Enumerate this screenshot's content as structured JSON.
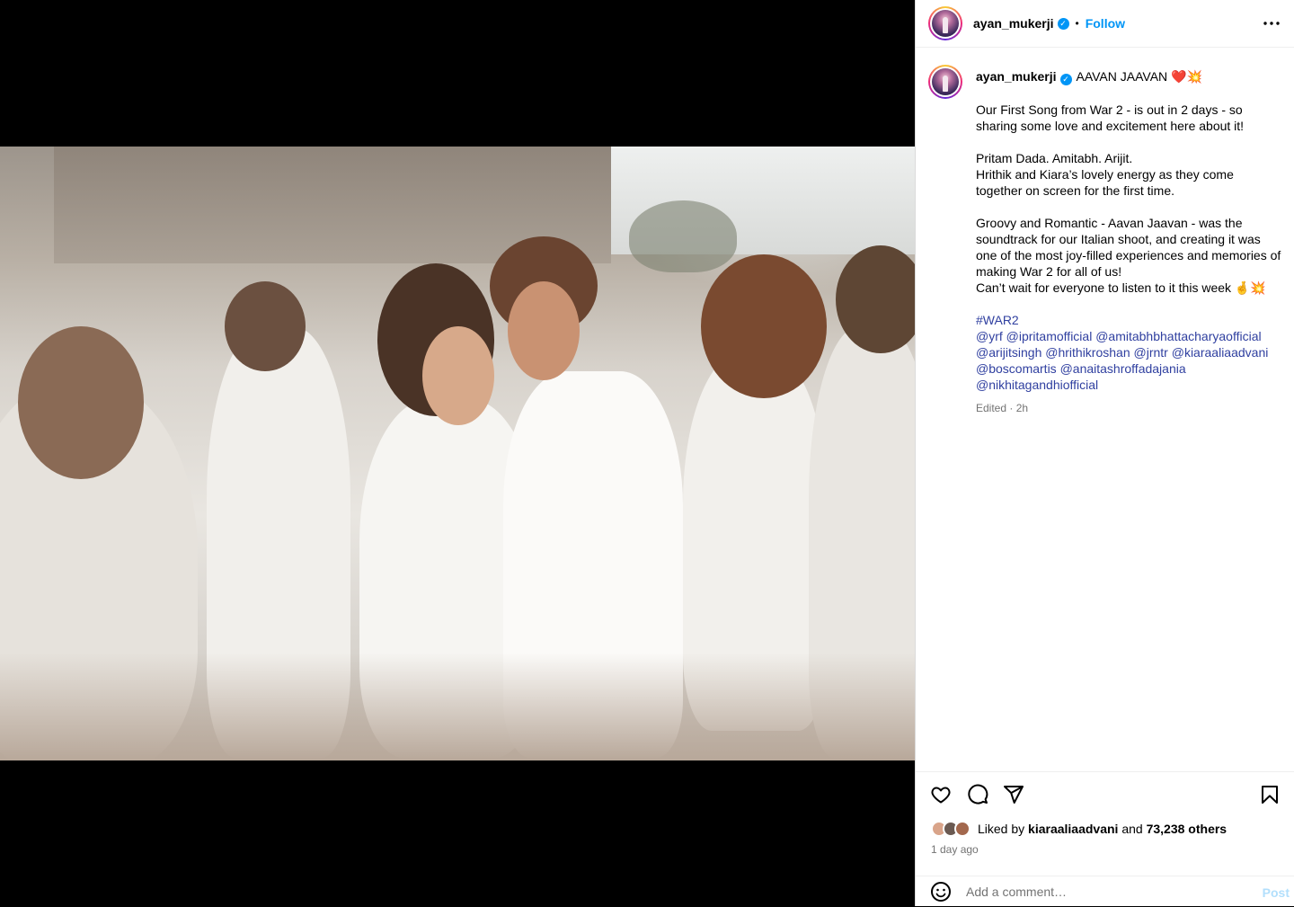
{
  "post": {
    "username": "ayan_mukerji",
    "follow_label": "Follow",
    "separator": "•",
    "more_icon": "more-horizontal-icon"
  },
  "caption": {
    "username": "ayan_mukerji",
    "title": "AAVAN JAAVAN",
    "title_emoji": "❤️💥",
    "paragraph1": "Our First Song from War 2 - is out in 2 days - so sharing some love and excitement here about it!",
    "paragraph2": "Pritam Dada. Amitabh. Arijit.\nHrithik and Kiara’s lovely energy as they come together on screen for the first time.",
    "paragraph3": "Groovy and Romantic - Aavan Jaavan - was the soundtrack for our Italian shoot, and creating it was one of the most joy-filled experiences and memories of making War 2 for all of us!\nCan’t wait for everyone to listen to it this week 🤞💥",
    "hashtag": "#WAR2",
    "mentions": [
      "@yrf",
      "@ipritamofficial",
      "@amitabhbhattacharyaofficial",
      "@arijitsingh",
      "@hrithikroshan",
      "@jrntr",
      "@kiaraaliaadvani",
      "@boscomartis",
      "@anaitashroffadajania",
      "@nikhitagandhiofficial"
    ],
    "edited": "Edited · 2h"
  },
  "actions": {
    "like_icon": "heart-icon",
    "comment_icon": "comment-icon",
    "share_icon": "share-icon",
    "save_icon": "bookmark-icon"
  },
  "likes": {
    "prefix": "Liked by",
    "user": "kiaraaliaadvani",
    "and": "and",
    "others": "73,238 others"
  },
  "timestamp": "1 day ago",
  "comment": {
    "emoji_icon": "smile-icon",
    "placeholder": "Add a comment…",
    "post_label": "Post"
  },
  "colors": {
    "accent": "#0095f6",
    "link": "#00376b",
    "muted": "#737373",
    "post_disabled": "#b2dffc"
  }
}
